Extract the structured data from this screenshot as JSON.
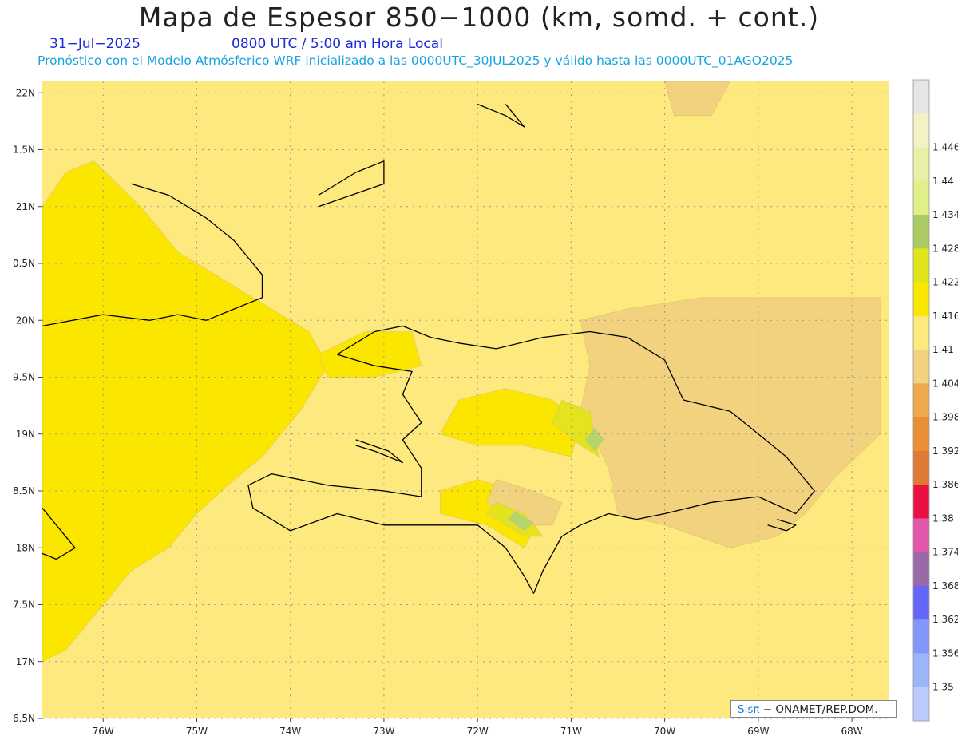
{
  "header": {
    "title": "Mapa de Espesor 850−1000 (km, somd. + cont.)",
    "date": "31−Jul−2025",
    "time": "0800 UTC / 5:00 am Hora Local",
    "forecast": "Pronóstico con el Modelo Atmósferico WRF inicializado a las 0000UTC_30JUL2025 y válido hasta las  0000UTC_01AGO2025"
  },
  "credit": {
    "prefix": "Sisπ",
    "suffix": "− ONAMET/REP.DOM."
  },
  "map": {
    "lon_range": [
      -76.65,
      -67.6
    ],
    "lat_range": [
      16.5,
      22.1
    ],
    "lon_ticks": [
      {
        "value": -76,
        "label": "76W"
      },
      {
        "value": -75,
        "label": "75W"
      },
      {
        "value": -74,
        "label": "74W"
      },
      {
        "value": -73,
        "label": "73W"
      },
      {
        "value": -72,
        "label": "72W"
      },
      {
        "value": -71,
        "label": "71W"
      },
      {
        "value": -70,
        "label": "70W"
      },
      {
        "value": -69,
        "label": "69W"
      },
      {
        "value": -68,
        "label": "68W"
      }
    ],
    "lat_ticks": [
      {
        "value": 22,
        "label": "22N"
      },
      {
        "value": 21.5,
        "label": "1.5N"
      },
      {
        "value": 21,
        "label": "21N"
      },
      {
        "value": 20.5,
        "label": "0.5N"
      },
      {
        "value": 20,
        "label": "20N"
      },
      {
        "value": 19.5,
        "label": "9.5N"
      },
      {
        "value": 19,
        "label": "19N"
      },
      {
        "value": 18.5,
        "label": "8.5N"
      },
      {
        "value": 18,
        "label": "18N"
      },
      {
        "value": 17.5,
        "label": "7.5N"
      },
      {
        "value": 17,
        "label": "17N"
      },
      {
        "value": 16.5,
        "label": "6.5N"
      }
    ],
    "background_color": "#fde97d",
    "regions": [
      {
        "level": 1.416,
        "color": "#fbe600",
        "points": [
          [
            -76.65,
            21.0
          ],
          [
            -76.4,
            21.3
          ],
          [
            -76.1,
            21.4
          ],
          [
            -75.6,
            21.0
          ],
          [
            -75.2,
            20.6
          ],
          [
            -74.6,
            20.3
          ],
          [
            -74.0,
            20.0
          ],
          [
            -73.8,
            19.9
          ],
          [
            -73.6,
            19.6
          ],
          [
            -73.9,
            19.2
          ],
          [
            -74.3,
            18.8
          ],
          [
            -74.6,
            18.6
          ],
          [
            -75.0,
            18.3
          ],
          [
            -75.3,
            18.0
          ],
          [
            -75.7,
            17.8
          ],
          [
            -76.1,
            17.4
          ],
          [
            -76.4,
            17.1
          ],
          [
            -76.65,
            17.0
          ]
        ]
      },
      {
        "level": 1.416,
        "color": "#fbe600",
        "points": [
          [
            -73.7,
            19.7
          ],
          [
            -73.2,
            19.9
          ],
          [
            -72.7,
            19.9
          ],
          [
            -72.6,
            19.6
          ],
          [
            -73.1,
            19.5
          ],
          [
            -73.6,
            19.5
          ]
        ]
      },
      {
        "level": 1.416,
        "color": "#fbe600",
        "points": [
          [
            -72.2,
            19.3
          ],
          [
            -71.7,
            19.4
          ],
          [
            -71.2,
            19.3
          ],
          [
            -70.9,
            19.1
          ],
          [
            -71.0,
            18.8
          ],
          [
            -71.5,
            18.9
          ],
          [
            -72.0,
            18.9
          ],
          [
            -72.4,
            19.0
          ]
        ]
      },
      {
        "level": 1.416,
        "color": "#fbe600",
        "points": [
          [
            -72.4,
            18.5
          ],
          [
            -72.0,
            18.6
          ],
          [
            -71.6,
            18.5
          ],
          [
            -71.3,
            18.3
          ],
          [
            -71.5,
            18.0
          ],
          [
            -71.9,
            18.2
          ],
          [
            -72.4,
            18.3
          ]
        ]
      },
      {
        "level": 1.404,
        "color": "#f2d17f",
        "points": [
          [
            -70.9,
            20.0
          ],
          [
            -70.4,
            20.1
          ],
          [
            -69.6,
            20.2
          ],
          [
            -68.6,
            20.2
          ],
          [
            -67.7,
            20.2
          ],
          [
            -67.7,
            19.0
          ],
          [
            -68.2,
            18.6
          ],
          [
            -68.5,
            18.3
          ],
          [
            -68.8,
            18.1
          ],
          [
            -69.3,
            18.0
          ],
          [
            -70.0,
            18.2
          ],
          [
            -70.5,
            18.3
          ],
          [
            -70.6,
            18.7
          ],
          [
            -70.9,
            19.2
          ],
          [
            -70.8,
            19.6
          ]
        ]
      },
      {
        "level": 1.404,
        "color": "#f2d17f",
        "points": [
          [
            -71.8,
            18.6
          ],
          [
            -71.4,
            18.5
          ],
          [
            -71.1,
            18.4
          ],
          [
            -71.2,
            18.2
          ],
          [
            -71.6,
            18.2
          ],
          [
            -71.9,
            18.4
          ]
        ]
      },
      {
        "level": 1.404,
        "color": "#f2d17f",
        "points": [
          [
            -70.0,
            22.1
          ],
          [
            -69.3,
            22.1
          ],
          [
            -69.5,
            21.8
          ],
          [
            -69.9,
            21.8
          ]
        ]
      },
      {
        "level": 1.422,
        "color": "#e4e41e",
        "points": [
          [
            -71.1,
            19.3
          ],
          [
            -70.8,
            19.2
          ],
          [
            -70.7,
            18.8
          ],
          [
            -70.9,
            18.9
          ],
          [
            -71.2,
            19.1
          ]
        ]
      },
      {
        "level": 1.422,
        "color": "#e4e41e",
        "points": [
          [
            -71.8,
            18.4
          ],
          [
            -71.5,
            18.3
          ],
          [
            -71.3,
            18.1
          ],
          [
            -71.5,
            18.1
          ],
          [
            -71.9,
            18.3
          ]
        ]
      },
      {
        "level": 1.428,
        "color": "#b5d56c",
        "points": [
          [
            -70.75,
            18.85
          ],
          [
            -70.65,
            18.95
          ],
          [
            -70.75,
            19.05
          ],
          [
            -70.85,
            18.95
          ]
        ]
      },
      {
        "level": 1.428,
        "color": "#b5d56c",
        "points": [
          [
            -71.6,
            18.32
          ],
          [
            -71.4,
            18.22
          ],
          [
            -71.5,
            18.15
          ],
          [
            -71.68,
            18.25
          ]
        ]
      }
    ],
    "coastlines": [
      {
        "name": "cuba-north",
        "points": [
          [
            -76.65,
            19.95
          ],
          [
            -76.0,
            20.05
          ],
          [
            -75.5,
            20.0
          ],
          [
            -75.2,
            20.05
          ],
          [
            -74.9,
            20.0
          ],
          [
            -74.6,
            20.1
          ],
          [
            -74.3,
            20.2
          ],
          [
            -74.3,
            20.4
          ],
          [
            -74.6,
            20.7
          ],
          [
            -74.9,
            20.9
          ],
          [
            -75.3,
            21.1
          ],
          [
            -75.7,
            21.2
          ]
        ]
      },
      {
        "name": "cuba-south",
        "points": [
          [
            -76.65,
            18.35
          ],
          [
            -76.5,
            18.2
          ],
          [
            -76.3,
            18.0
          ],
          [
            -76.5,
            17.9
          ],
          [
            -76.65,
            17.95
          ]
        ]
      },
      {
        "name": "hispaniola",
        "points": [
          [
            -73.5,
            19.7
          ],
          [
            -73.1,
            19.9
          ],
          [
            -72.8,
            19.95
          ],
          [
            -72.5,
            19.85
          ],
          [
            -72.2,
            19.8
          ],
          [
            -71.8,
            19.75
          ],
          [
            -71.3,
            19.85
          ],
          [
            -70.8,
            19.9
          ],
          [
            -70.4,
            19.85
          ],
          [
            -70.0,
            19.65
          ],
          [
            -69.8,
            19.3
          ],
          [
            -69.3,
            19.2
          ],
          [
            -69.0,
            19.0
          ],
          [
            -68.7,
            18.8
          ],
          [
            -68.4,
            18.5
          ],
          [
            -68.6,
            18.3
          ],
          [
            -69.0,
            18.45
          ],
          [
            -69.5,
            18.4
          ],
          [
            -70.0,
            18.3
          ],
          [
            -70.3,
            18.25
          ],
          [
            -70.6,
            18.3
          ],
          [
            -70.9,
            18.2
          ],
          [
            -71.1,
            18.1
          ],
          [
            -71.3,
            17.8
          ],
          [
            -71.4,
            17.6
          ],
          [
            -71.5,
            17.75
          ],
          [
            -71.7,
            18.0
          ],
          [
            -72.0,
            18.2
          ],
          [
            -72.5,
            18.2
          ],
          [
            -73.0,
            18.2
          ],
          [
            -73.5,
            18.3
          ],
          [
            -74.0,
            18.15
          ],
          [
            -74.4,
            18.35
          ],
          [
            -74.45,
            18.55
          ],
          [
            -74.2,
            18.65
          ],
          [
            -73.6,
            18.55
          ],
          [
            -73.0,
            18.5
          ],
          [
            -72.6,
            18.45
          ],
          [
            -72.6,
            18.7
          ],
          [
            -72.8,
            18.95
          ],
          [
            -72.6,
            19.1
          ],
          [
            -72.8,
            19.35
          ],
          [
            -72.7,
            19.55
          ],
          [
            -73.1,
            19.6
          ],
          [
            -73.5,
            19.7
          ]
        ]
      },
      {
        "name": "gonave",
        "points": [
          [
            -73.3,
            18.95
          ],
          [
            -72.95,
            18.85
          ],
          [
            -72.8,
            18.75
          ],
          [
            -73.1,
            18.85
          ],
          [
            -73.3,
            18.9
          ]
        ]
      },
      {
        "name": "great-inagua",
        "points": [
          [
            -73.7,
            21.0
          ],
          [
            -73.0,
            21.2
          ],
          [
            -73.0,
            21.4
          ],
          [
            -73.3,
            21.3
          ],
          [
            -73.7,
            21.1
          ]
        ]
      },
      {
        "name": "turks-caicos",
        "points": [
          [
            -72.0,
            21.9
          ],
          [
            -71.7,
            21.8
          ],
          [
            -71.5,
            21.7
          ],
          [
            -71.7,
            21.9
          ]
        ]
      },
      {
        "name": "saona",
        "points": [
          [
            -68.9,
            18.2
          ],
          [
            -68.7,
            18.15
          ],
          [
            -68.6,
            18.2
          ],
          [
            -68.8,
            18.25
          ]
        ]
      }
    ],
    "colorbar": {
      "levels": [
        {
          "label": "",
          "color": "#e6e6e6"
        },
        {
          "label": "1.446",
          "color": "#f2f2c4"
        },
        {
          "label": "1.44",
          "color": "#e8f0a6"
        },
        {
          "label": "1.434",
          "color": "#e0ef88"
        },
        {
          "label": "1.428",
          "color": "#aacb63"
        },
        {
          "label": "1.422",
          "color": "#dfe51a"
        },
        {
          "label": "1.416",
          "color": "#fbe600"
        },
        {
          "label": "1.41",
          "color": "#fde97d"
        },
        {
          "label": "1.404",
          "color": "#f2d17f"
        },
        {
          "label": "1.398",
          "color": "#f0aa4c"
        },
        {
          "label": "1.392",
          "color": "#ea8f34"
        },
        {
          "label": "1.386",
          "color": "#de7a34"
        },
        {
          "label": "1.38",
          "color": "#ea1042"
        },
        {
          "label": "1.374",
          "color": "#e156a8"
        },
        {
          "label": "1.368",
          "color": "#9a69aa"
        },
        {
          "label": "1.362",
          "color": "#6567fb"
        },
        {
          "label": "1.356",
          "color": "#8396fb"
        },
        {
          "label": "1.35",
          "color": "#9cb6fb"
        },
        {
          "label": "",
          "color": "#bccbfb"
        }
      ]
    }
  }
}
